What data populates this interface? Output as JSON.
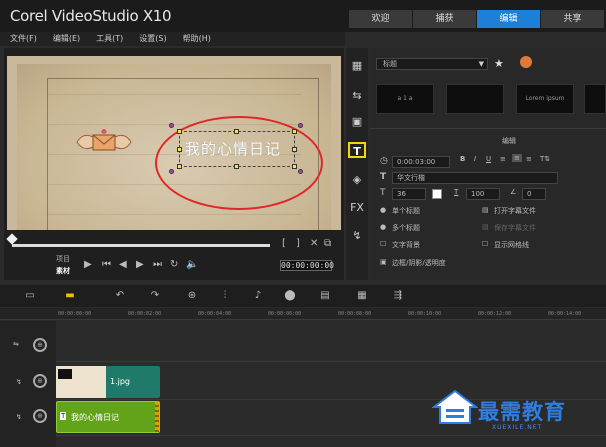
{
  "app": {
    "title": "Corel VideoStudio X10",
    "tabs": [
      {
        "label": "欢迎",
        "active": false
      },
      {
        "label": "捕获",
        "active": false
      },
      {
        "label": "编辑",
        "active": true
      },
      {
        "label": "共享",
        "active": false
      }
    ],
    "accent_color": "#1d7fd6"
  },
  "menu": {
    "items": [
      "文件(F)",
      "编辑(E)",
      "工具(T)",
      "设置(S)",
      "帮助(H)"
    ]
  },
  "player": {
    "overlay_title": "我的心情日记",
    "mode_project": "项目",
    "mode_clip": "素材",
    "timecode": "00:00:00:00",
    "highlight_color": "#e0262a"
  },
  "library": {
    "category": "标题",
    "thumbnails": [
      "a 1 a",
      "",
      "Lorem ipsum",
      ""
    ],
    "section_label": "编辑",
    "duration": "0:00:03:00",
    "font_name": "华文行楷",
    "font_size": "36",
    "line_spacing": "100",
    "angle": "0",
    "single_title": "单个标题",
    "multi_title": "多个标题",
    "open_subtitle": "打开字幕文件",
    "save_subtitle": "保存字幕文件",
    "text_background": "文字背景",
    "show_grid": "显示网格线",
    "border_shadow": "边框/阴影/透明度"
  },
  "side_icons": [
    "media-icon",
    "transition-icon",
    "graphic-icon",
    "title-icon",
    "instant-project-icon",
    "fx-icon",
    "path-icon"
  ],
  "timeline": {
    "ruler": [
      "00:00:00:00",
      "00:00:02:00",
      "00:00:04:00",
      "00:00:06:00",
      "00:00:08:00",
      "00:00:10:00",
      "00:00:12:00",
      "00:00:14:00"
    ],
    "clips": {
      "video_label": "1.jpg",
      "title_label": "我的心情日记"
    }
  },
  "watermark": {
    "text": "最需教育",
    "sub": "XUEXILE.NET"
  }
}
